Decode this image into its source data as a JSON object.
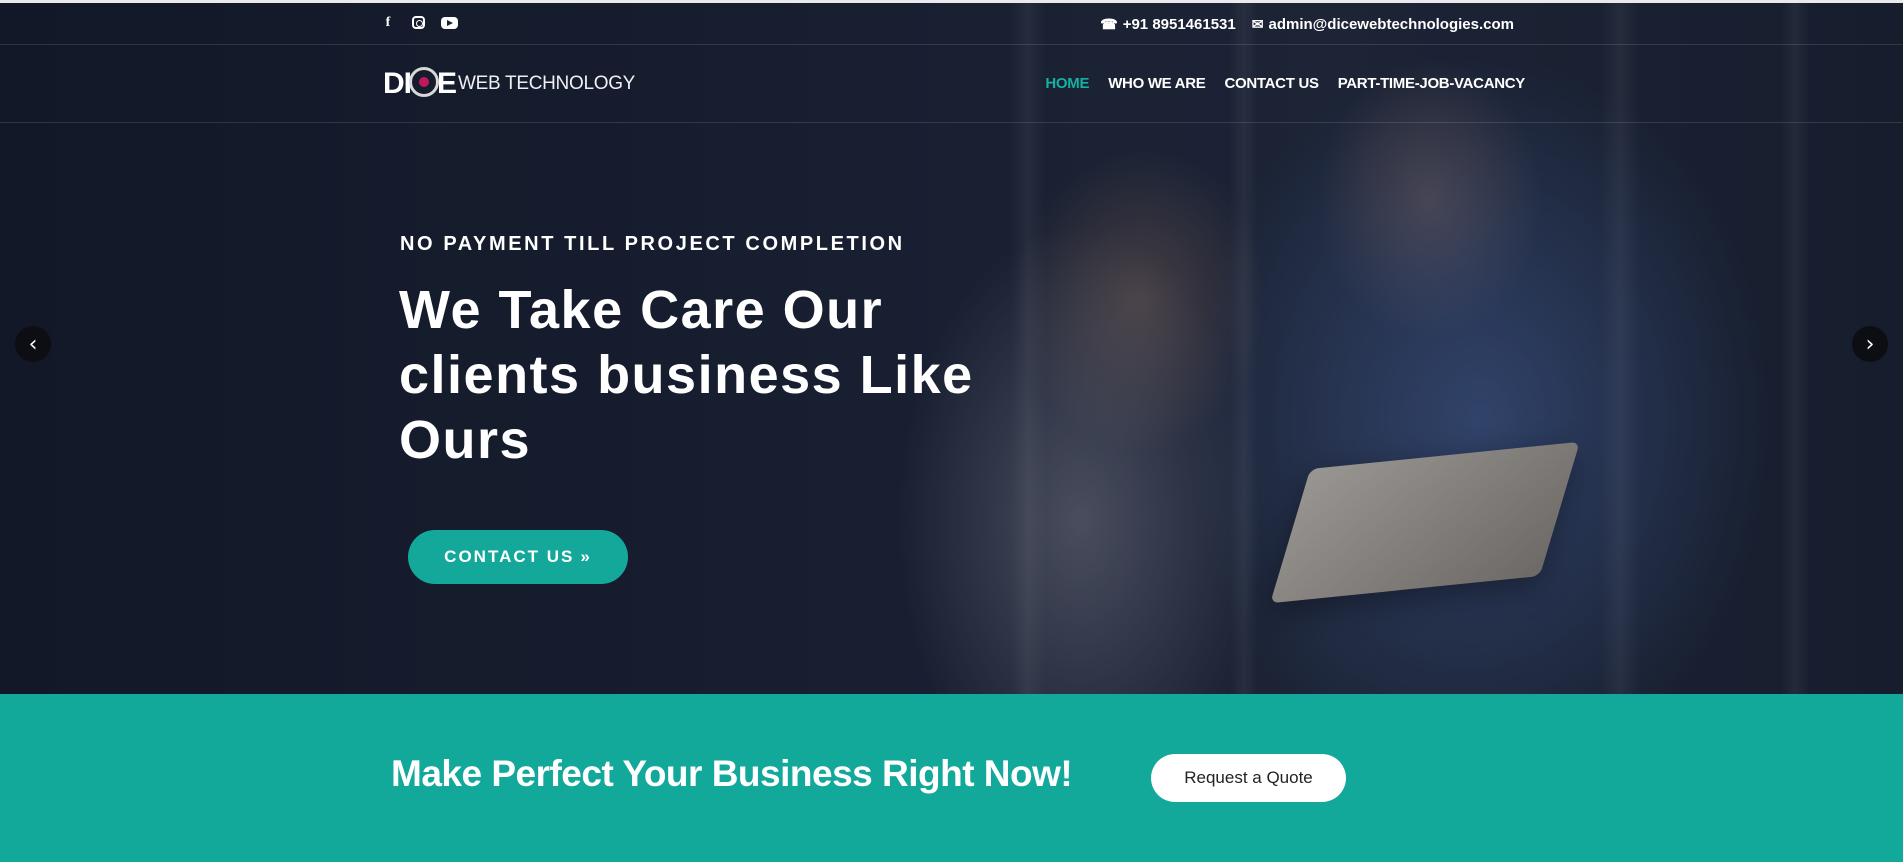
{
  "topbar": {
    "social_icons": [
      "facebook-icon",
      "instagram-icon",
      "youtube-icon"
    ],
    "phone_icon": "phone-icon",
    "phone": "+91 8951461531",
    "email_icon": "envelope-icon",
    "email": "admin@dicewebtechnologies.com"
  },
  "nav": {
    "logo_mark": "DI E",
    "logo_text": "WEB TECHNOLOGY",
    "items": [
      {
        "label": "HOME",
        "active": true
      },
      {
        "label": "WHO WE ARE",
        "active": false
      },
      {
        "label": "CONTACT US",
        "active": false
      },
      {
        "label": "PART-TIME-JOB-VACANCY",
        "active": false
      }
    ]
  },
  "hero": {
    "kicker": "NO PAYMENT TILL PROJECT COMPLETION",
    "headline_lines": [
      "We Take Care Our",
      "clients business Like",
      "Ours"
    ],
    "cta_label": "CONTACT US",
    "cta_icon": "double-chevron-right-icon",
    "prev_icon": "chevron-left-icon",
    "next_icon": "chevron-right-icon"
  },
  "banner": {
    "title": "Make Perfect Your Business Right Now!",
    "button_label": "Request a Quote"
  },
  "colors": {
    "accent": "#14a89a",
    "hero_bg": "#1a2233",
    "active_nav": "#14b0a0"
  }
}
